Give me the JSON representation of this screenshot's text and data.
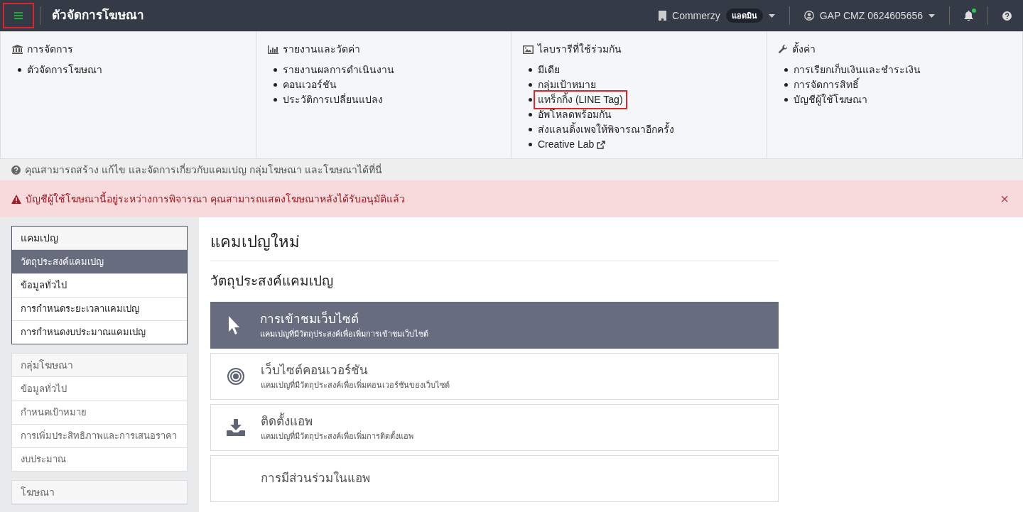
{
  "header": {
    "menu_highlighted": true,
    "title": "ตัวจัดการโฆษณา",
    "account": "Commerzy",
    "role_badge": "แอดมิน",
    "user": "GAP CMZ 0624605656",
    "notification_dot": true
  },
  "mega_menu": [
    {
      "kind": "bank",
      "heading": "การจัดการ",
      "items": [
        {
          "label": "ตัวจัดการโฆษณา",
          "highlighted": false,
          "external": false
        }
      ]
    },
    {
      "kind": "chart",
      "heading": "รายงานและวัดค่า",
      "items": [
        {
          "label": "รายงานผลการดำเนินงาน",
          "highlighted": false,
          "external": false
        },
        {
          "label": "คอนเวอร์ชัน",
          "highlighted": false,
          "external": false
        },
        {
          "label": "ประวัติการเปลี่ยนแปลง",
          "highlighted": false,
          "external": false
        }
      ]
    },
    {
      "kind": "image",
      "heading": "ไลบรารีที่ใช้ร่วมกัน",
      "items": [
        {
          "label": "มีเดีย",
          "highlighted": false,
          "external": false
        },
        {
          "label": "กลุ่มเป้าหมาย",
          "highlighted": false,
          "external": false
        },
        {
          "label": "แทร็กกิ้ง (LINE Tag)",
          "highlighted": true,
          "external": false
        },
        {
          "label": "อัพโหลดพร้อมกัน",
          "highlighted": false,
          "external": false
        },
        {
          "label": "ส่งแลนดิ้งเพจให้พิจารณาอีกครั้ง",
          "highlighted": false,
          "external": false
        },
        {
          "label": "Creative Lab",
          "highlighted": false,
          "external": true
        }
      ]
    },
    {
      "kind": "wrench",
      "heading": "ตั้งค่า",
      "items": [
        {
          "label": "การเรียกเก็บเงินและชำระเงิน",
          "highlighted": false,
          "external": false
        },
        {
          "label": "การจัดการสิทธิ์",
          "highlighted": false,
          "external": false
        },
        {
          "label": "บัญชีผู้ใช้โฆษณา",
          "highlighted": false,
          "external": false
        }
      ]
    }
  ],
  "info_text": "คุณสามารถสร้าง แก้ไข และจัดการเกี่ยวกับแคมเปญ กลุ่มโฆษณา และโฆษณาได้ที่นี่",
  "alert": {
    "text": "บัญชีผู้ใช้โฆษณานี้อยู่ระหว่างการพิจารณา คุณสามารถแสดงโฆษณาหลังได้รับอนุมัติแล้ว",
    "close": "×"
  },
  "sidebar": [
    {
      "heading": "แคมเปญ",
      "active": true,
      "items": [
        {
          "label": "วัตถุประสงค์แคมเปญ",
          "selected": true
        },
        {
          "label": "ข้อมูลทั่วไป",
          "selected": false
        },
        {
          "label": "การกำหนดระยะเวลาแคมเปญ",
          "selected": false
        },
        {
          "label": "การกำหนดงบประมาณแคมเปญ",
          "selected": false
        }
      ]
    },
    {
      "heading": "กลุ่มโฆษณา",
      "active": false,
      "items": [
        {
          "label": "ข้อมูลทั่วไป",
          "selected": false
        },
        {
          "label": "กำหนดเป้าหมาย",
          "selected": false
        },
        {
          "label": "การเพิ่มประสิทธิภาพและการเสนอราคา",
          "selected": false
        },
        {
          "label": "งบประมาณ",
          "selected": false
        }
      ]
    },
    {
      "heading": "โฆษณา",
      "active": false
    }
  ],
  "content": {
    "title": "แคมเปญใหม่",
    "subtitle": "วัตถุประสงค์แคมเปญ",
    "objectives": [
      {
        "kind": "cursor",
        "title": "การเข้าชมเว็บไซต์",
        "description": "แคมเปญที่มีวัตถุประสงค์เพื่อเพิ่มการเข้าชมเว็บไซต์",
        "selected": true
      },
      {
        "kind": "target",
        "title": "เว็บไซต์คอนเวอร์ชัน",
        "description": "แคมเปญที่มีวัตถุประสงค์เพื่อเพิ่มคอนเวอร์ชันของเว็บไซต์",
        "selected": false
      },
      {
        "kind": "download",
        "title": "ติดตั้งแอพ",
        "description": "แคมเปญที่มีวัตถุประสงค์เพื่อเพิ่มการติดตั้งแอพ",
        "selected": false
      },
      {
        "kind": "none",
        "title": "การมีส่วนร่วมในแอพ",
        "selected": false
      }
    ]
  }
}
